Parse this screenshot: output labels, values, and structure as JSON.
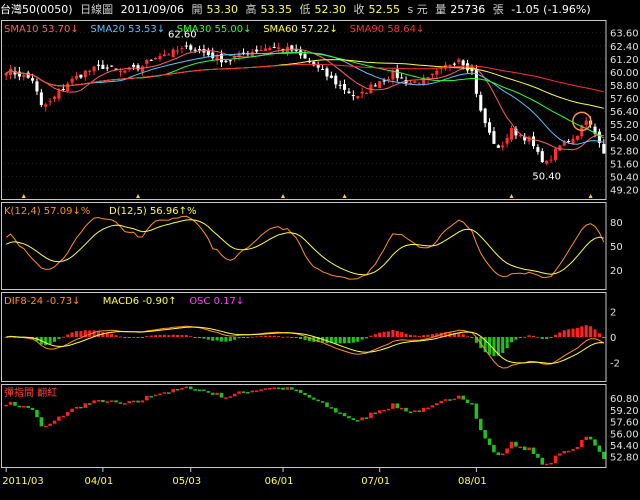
{
  "header": {
    "symbol": "台灣50(0050)",
    "period": "日線圖",
    "date": "2011/09/06",
    "open_label": "開",
    "open": "53.30",
    "high_label": "高",
    "high": "53.35",
    "low_label": "低",
    "low": "52.30",
    "close_label": "收",
    "close": "52.55",
    "close_unit": "s 元",
    "vol_label": "量",
    "volume": "25736",
    "vol_unit": "張",
    "change": "-1.05 (-1.96%)"
  },
  "panels": {
    "price": {
      "legend": [
        {
          "name": "SMA10",
          "value": "53.70",
          "arrow": "↓",
          "color": "#ff6060"
        },
        {
          "name": "SMA20",
          "value": "53.53",
          "arrow": "↓",
          "color": "#60c0ff"
        },
        {
          "name": "SMA30",
          "value": "55.00",
          "arrow": "↓",
          "color": "#30ff30"
        },
        {
          "name": "SMA60",
          "value": "57.22",
          "arrow": "↓",
          "color": "#ffff40"
        },
        {
          "name": "SMA90",
          "value": "58.64",
          "arrow": "↓",
          "color": "#ff3030"
        }
      ],
      "yticks": [
        "63.60",
        "62.40",
        "61.20",
        "60.00",
        "58.80",
        "57.60",
        "56.40",
        "55.20",
        "54.00",
        "52.80",
        "51.60",
        "50.40",
        "49.20"
      ],
      "ylim": [
        48.6,
        64.4
      ],
      "high_annotation": "62.60",
      "low_annotation": "50.40"
    },
    "kd": {
      "legend": [
        {
          "name": "K(12,4)",
          "value": "57.09",
          "arrow": "↓",
          "unit": "%",
          "color": "#ff9020"
        },
        {
          "name": "D(12,5)",
          "value": "56.96",
          "arrow": "↑",
          "unit": "%",
          "color": "#ffff40"
        }
      ],
      "yticks": [
        "80",
        "50",
        "20"
      ],
      "ylim": [
        0,
        100
      ]
    },
    "macd": {
      "legend": [
        {
          "name": "DIF8-24",
          "value": "-0.73",
          "arrow": "↓",
          "color": "#ff9020"
        },
        {
          "name": "MACD6",
          "value": "-0.90",
          "arrow": "↑",
          "color": "#ffff40"
        },
        {
          "name": "OSC",
          "value": "0.17",
          "arrow": "↓",
          "color": "#ff40ff"
        }
      ],
      "yticks": [
        "2",
        "0",
        "-2"
      ],
      "ylim": [
        -3.2,
        3.2
      ]
    },
    "rev": {
      "legend": [
        {
          "name": "彈指間 翻紅",
          "value": "",
          "arrow": "",
          "color": "#ff4040"
        }
      ],
      "yticks": [
        "60.80",
        "59.20",
        "57.60",
        "56.00",
        "54.40",
        "52.80"
      ],
      "ylim": [
        51.8,
        62.2
      ]
    }
  },
  "xaxis": {
    "labels": [
      "2011/03",
      "04/01",
      "05/03",
      "06/01",
      "07/01",
      "08/01"
    ],
    "label_index": [
      0,
      22,
      42,
      63,
      85,
      107
    ]
  },
  "chart_data": {
    "type": "candlestick",
    "title": "台灣50(0050) 日線圖",
    "anchors": [
      [
        0,
        60.2
      ],
      [
        6,
        59.3
      ],
      [
        8,
        56.8
      ],
      [
        10,
        57.2
      ],
      [
        14,
        59.0
      ],
      [
        18,
        60.0
      ],
      [
        22,
        60.5
      ],
      [
        26,
        60.0
      ],
      [
        30,
        60.3
      ],
      [
        34,
        61.5
      ],
      [
        38,
        61.8
      ],
      [
        42,
        62.3
      ],
      [
        46,
        61.6
      ],
      [
        50,
        61.0
      ],
      [
        55,
        61.8
      ],
      [
        60,
        62.3
      ],
      [
        65,
        62.0
      ],
      [
        70,
        60.6
      ],
      [
        75,
        59.0
      ],
      [
        80,
        57.6
      ],
      [
        84,
        59.0
      ],
      [
        88,
        59.8
      ],
      [
        92,
        59.0
      ],
      [
        96,
        59.3
      ],
      [
        100,
        60.5
      ],
      [
        103,
        61.3
      ],
      [
        106,
        60.0
      ],
      [
        108,
        56.3
      ],
      [
        110,
        54.3
      ],
      [
        112,
        52.8
      ],
      [
        115,
        54.6
      ],
      [
        119,
        53.8
      ],
      [
        121,
        52.4
      ],
      [
        123,
        51.6
      ],
      [
        126,
        53.2
      ],
      [
        130,
        54.3
      ],
      [
        132,
        55.8
      ],
      [
        134,
        54.2
      ],
      [
        136,
        52.5
      ]
    ],
    "n_bars": 137,
    "seed": 7,
    "series": [
      {
        "name": "SMA10",
        "window": 10
      },
      {
        "name": "SMA20",
        "window": 20
      },
      {
        "name": "SMA30",
        "window": 30
      },
      {
        "name": "SMA60",
        "window": 60
      },
      {
        "name": "SMA90",
        "window": 90
      }
    ]
  }
}
